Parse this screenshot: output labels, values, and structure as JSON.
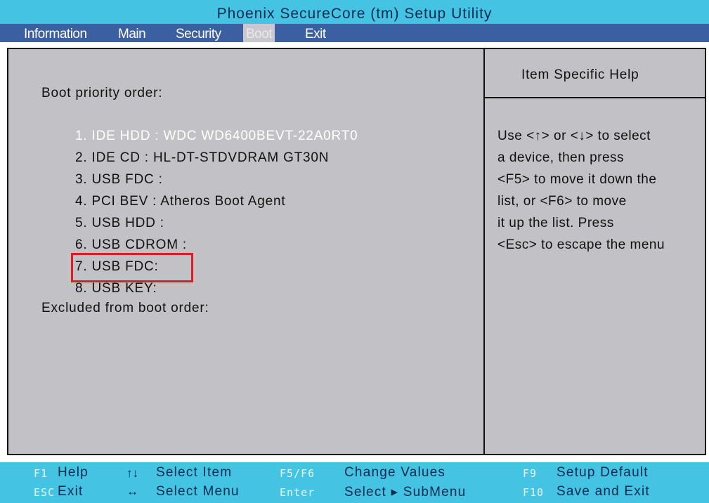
{
  "window": {
    "title": "Phoenix SecureCore (tm) Setup Utility"
  },
  "menu": {
    "items": [
      {
        "label": "Information"
      },
      {
        "label": "Main"
      },
      {
        "label": "Security"
      },
      {
        "label": "Boot"
      },
      {
        "label": "Exit"
      }
    ],
    "active": "Boot"
  },
  "boot": {
    "heading": "Boot priority order:",
    "items": [
      "1. IDE HDD : WDC WD6400BEVT-22A0RT0",
      "2. IDE CD : HL-DT-STDVDRAM GT30N",
      "3. USB FDC :",
      "4. PCI BEV : Atheros Boot Agent",
      "5. USB HDD :",
      "6. USB CDROM :",
      "7. USB FDC:",
      "8. USB KEY:"
    ],
    "selected_index": 0,
    "excluded_label": "Excluded from boot order:"
  },
  "help": {
    "title": "Item Specific Help",
    "lines": [
      "Use <↑> or <↓> to select",
      "a device, then press",
      "<F5> to move it down the",
      "list, or <F6> to move",
      "it up the list. Press",
      "<Esc> to escape the menu"
    ]
  },
  "footer": {
    "f1_key": "F1",
    "f1_desc": "Help",
    "esc_key": "ESC",
    "esc_desc": "Exit",
    "updown_arrow": "↑↓",
    "select_item": "Select  Item",
    "leftright_arrow": "↔",
    "select_menu": "Select  Menu",
    "f5f6_key": "F5/F6",
    "f5f6_desc": "Change  Values",
    "enter_key": "Enter",
    "enter_desc": "Select  ▸  SubMenu",
    "f9_key": "F9",
    "f9_desc": "Setup  Default",
    "f10_key": "F10",
    "f10_desc": "Save  and  Exit"
  },
  "colors": {
    "title_bg": "#44c3e2",
    "menu_bg": "#3b5fa0",
    "panel_bg": "#c2c1c6",
    "highlight": "#e21b23"
  }
}
